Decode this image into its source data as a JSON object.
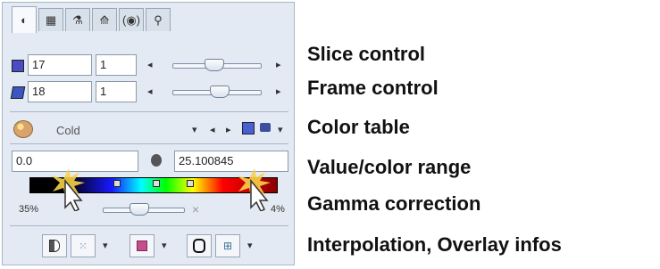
{
  "tabs": [
    {
      "label": "◐",
      "icon": "contrast-icon"
    },
    {
      "label": "▦",
      "icon": "grid-icon"
    },
    {
      "label": "⚗",
      "icon": "tools-icon"
    },
    {
      "label": "⟰",
      "icon": "curve-icon"
    },
    {
      "label": "(◉)",
      "icon": "signal-icon"
    },
    {
      "label": "⚲",
      "icon": "probe-icon"
    }
  ],
  "slice": {
    "value": "17",
    "step": "1"
  },
  "frame": {
    "value": "18",
    "step": "1"
  },
  "color_table": {
    "name": "Cold"
  },
  "range": {
    "min": "0.0",
    "max": "25.100845"
  },
  "gamma": {
    "left": "35%",
    "right": "4%",
    "close": "×"
  },
  "annotations": {
    "slice": "Slice control",
    "frame": "Frame control",
    "color": "Color table",
    "range": "Value/color range",
    "gamma": "Gamma correction",
    "interp": "Interpolation, Overlay infos"
  },
  "controls": {
    "left_arrow": "◂",
    "right_arrow": "▸",
    "dropdown": "▾"
  },
  "colors": {
    "panel": "#e3eaf3",
    "slice_square": "#4a4cc4",
    "frame_square": "#3b56c2"
  }
}
